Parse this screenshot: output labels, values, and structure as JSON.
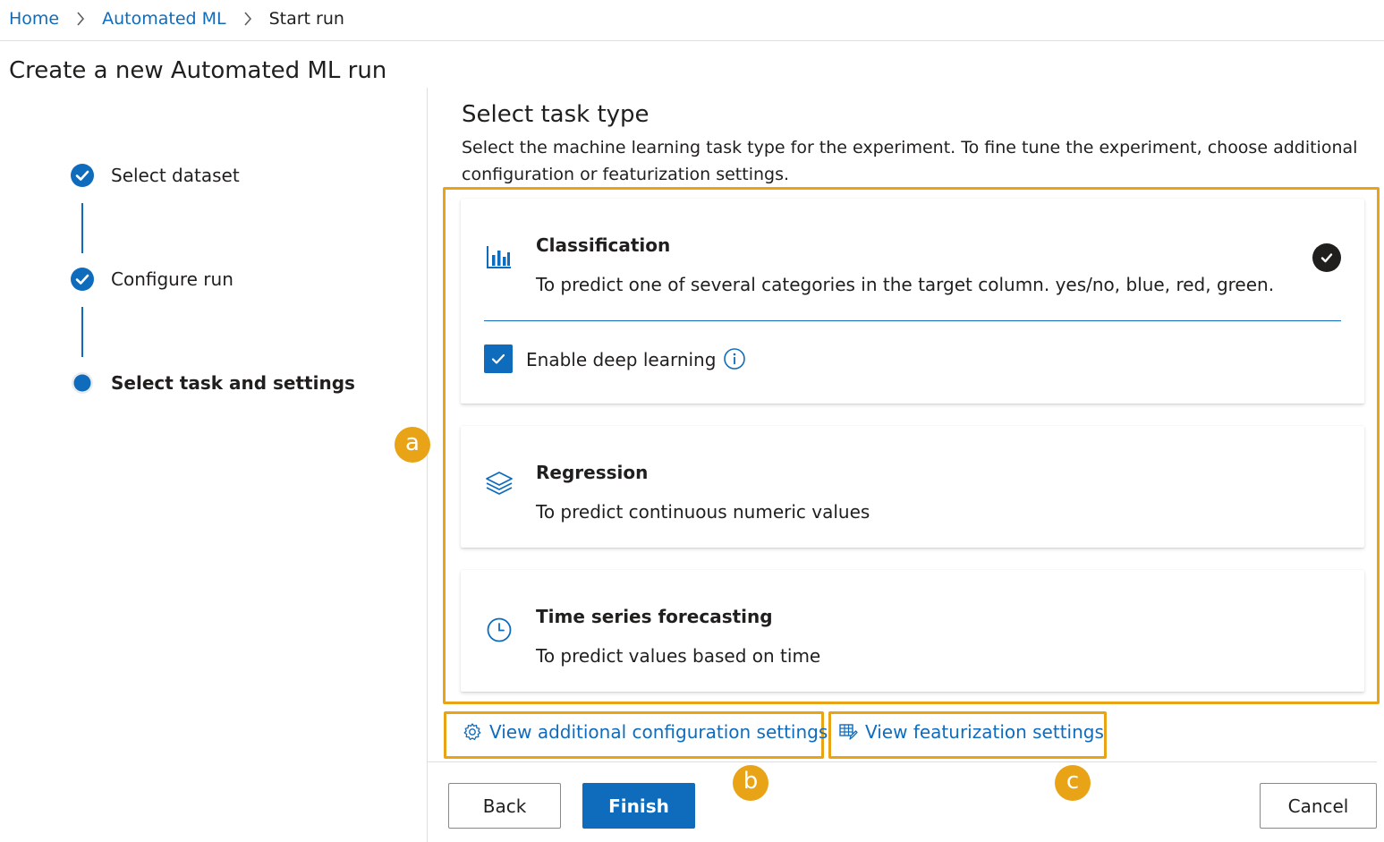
{
  "breadcrumb": {
    "items": [
      "Home",
      "Automated ML"
    ],
    "current": "Start run"
  },
  "page_title": "Create a new Automated ML run",
  "steps": [
    {
      "label": "Select dataset",
      "state": "complete"
    },
    {
      "label": "Configure run",
      "state": "complete"
    },
    {
      "label": "Select task and settings",
      "state": "current"
    }
  ],
  "task_section": {
    "title": "Select task type",
    "description": "Select the machine learning task type for the experiment. To fine tune the experiment, choose additional configuration or featurization settings."
  },
  "tasks": [
    {
      "icon": "bar-chart-icon",
      "title": "Classification",
      "description": "To predict one of several categories in the target column. yes/no, blue, red, green.",
      "selected": true
    },
    {
      "icon": "layers-icon",
      "title": "Regression",
      "description": "To predict continuous numeric values",
      "selected": false
    },
    {
      "icon": "clock-icon",
      "title": "Time series forecasting",
      "description": "To predict values based on time",
      "selected": false
    }
  ],
  "deep_learning": {
    "label": "Enable deep learning",
    "checked": true
  },
  "links": {
    "additional_config": "View additional configuration settings",
    "featurization": "View featurization settings"
  },
  "buttons": {
    "back": "Back",
    "finish": "Finish",
    "cancel": "Cancel"
  },
  "markers": [
    "a",
    "b",
    "c"
  ],
  "colors": {
    "accent": "#0f6cbd",
    "highlight": "#e8a317",
    "text": "#201f1e"
  }
}
